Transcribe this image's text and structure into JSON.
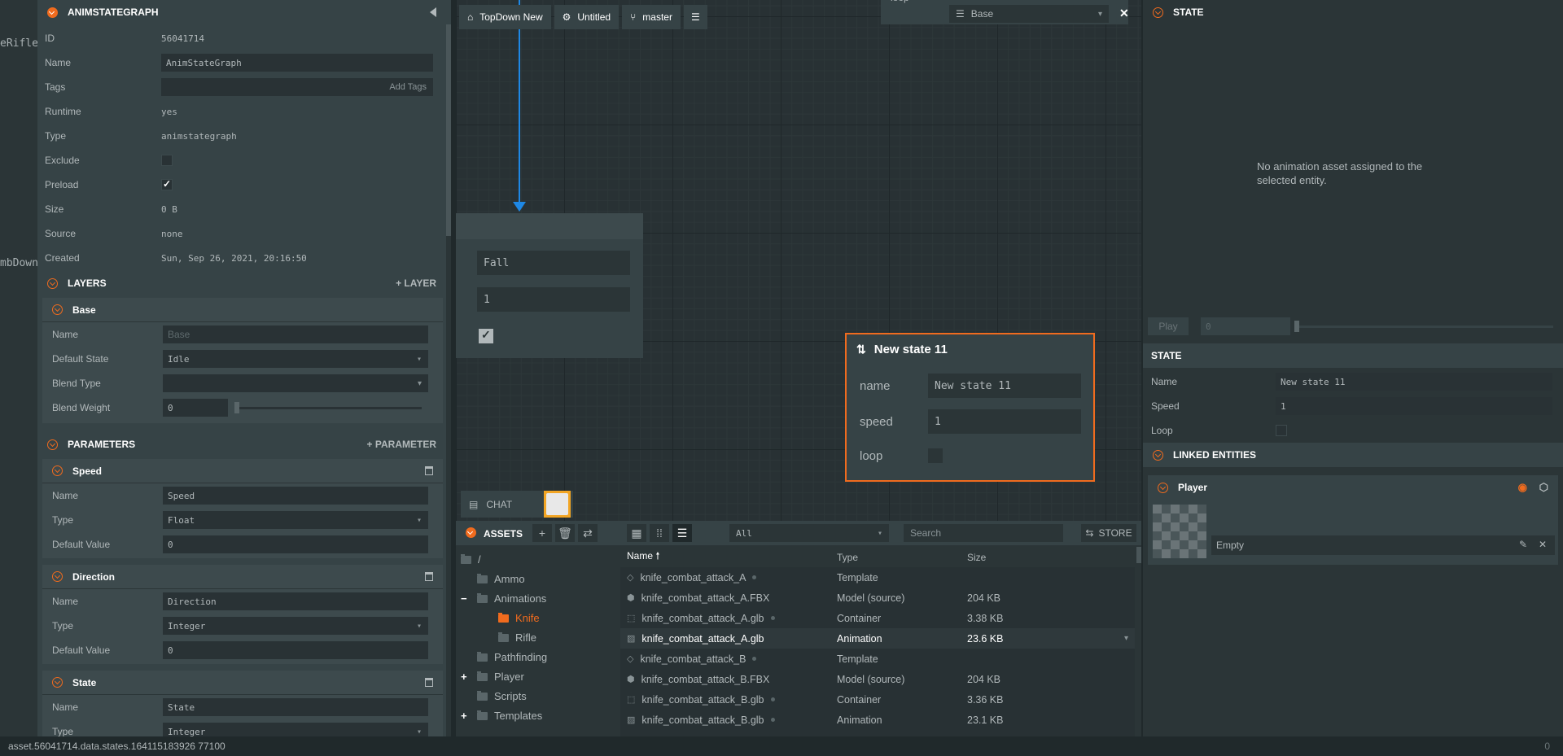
{
  "left_strip": {
    "line1": "eRifle",
    "line2": "mbDown"
  },
  "inspector": {
    "title": "ANIMSTATEGRAPH",
    "props": [
      {
        "label": "ID",
        "value": "56041714"
      },
      {
        "label": "Name",
        "value": "AnimStateGraph"
      },
      {
        "label": "Tags",
        "value": "",
        "action": "Add Tags"
      },
      {
        "label": "Runtime",
        "value": "yes"
      },
      {
        "label": "Type",
        "value": "animstategraph"
      },
      {
        "label": "Exclude",
        "checked": false
      },
      {
        "label": "Preload",
        "checked": true
      },
      {
        "label": "Size",
        "value": "0 B"
      },
      {
        "label": "Source",
        "value": "none"
      },
      {
        "label": "Created",
        "value": "Sun, Sep 26, 2021, 20:16:50"
      }
    ],
    "layers": {
      "title": "LAYERS",
      "add_label": "LAYER",
      "base": {
        "title": "Base",
        "name_label": "Name",
        "name_placeholder": "Base",
        "default_state_label": "Default State",
        "default_state_value": "Idle",
        "blend_type_label": "Blend Type",
        "blend_type_value": "",
        "blend_weight_label": "Blend Weight",
        "blend_weight_value": "0"
      }
    },
    "parameters": {
      "title": "PARAMETERS",
      "add_label": "PARAMETER",
      "items": [
        {
          "title": "Speed",
          "name": "Speed",
          "type": "Float",
          "default": "0"
        },
        {
          "title": "Direction",
          "name": "Direction",
          "type": "Integer",
          "default": "0"
        },
        {
          "title": "State",
          "name": "State",
          "type": "Integer",
          "default": ""
        }
      ],
      "name_label": "Name",
      "type_label": "Type",
      "default_label": "Default Value"
    }
  },
  "toolbar": {
    "project": "TopDown New",
    "scene": "Untitled",
    "branch": "master"
  },
  "layer_select": {
    "top_label": "loop",
    "value": "Base"
  },
  "graph": {
    "node_left": {
      "name": "Fall",
      "speed": "1",
      "loop": true
    },
    "node_selected": {
      "title": "New state 11",
      "name_label": "name",
      "name_value": "New state 11",
      "speed_label": "speed",
      "speed_value": "1",
      "loop_label": "loop",
      "loop": false
    }
  },
  "chat": {
    "label": "CHAT"
  },
  "assets": {
    "title": "ASSETS",
    "filter": "All",
    "search_placeholder": "Search",
    "store_label": "STORE",
    "tree": [
      {
        "label": "/",
        "level": 0
      },
      {
        "label": "Ammo",
        "level": 1
      },
      {
        "label": "Animations",
        "level": 1,
        "expanded": true
      },
      {
        "label": "Knife",
        "level": 2,
        "selected": true
      },
      {
        "label": "Rifle",
        "level": 2
      },
      {
        "label": "Pathfinding",
        "level": 1
      },
      {
        "label": "Player",
        "level": 1,
        "collapsed": true
      },
      {
        "label": "Scripts",
        "level": 1
      },
      {
        "label": "Templates",
        "level": 1,
        "collapsed": true
      }
    ],
    "columns": [
      "Name",
      "Type",
      "Size"
    ],
    "rows": [
      {
        "icon": "template-icon",
        "name": "knife_combat_attack_A",
        "dot": true,
        "type": "Template",
        "size": ""
      },
      {
        "icon": "model-icon",
        "name": "knife_combat_attack_A.FBX",
        "dot": false,
        "type": "Model (source)",
        "size": "204 KB"
      },
      {
        "icon": "container-icon",
        "name": "knife_combat_attack_A.glb",
        "dot": true,
        "type": "Container",
        "size": "3.38 KB"
      },
      {
        "icon": "animation-icon",
        "name": "knife_combat_attack_A.glb",
        "dot": false,
        "type": "Animation",
        "size": "23.6 KB",
        "selected": true
      },
      {
        "icon": "template-icon",
        "name": "knife_combat_attack_B",
        "dot": true,
        "type": "Template",
        "size": ""
      },
      {
        "icon": "model-icon",
        "name": "knife_combat_attack_B.FBX",
        "dot": false,
        "type": "Model (source)",
        "size": "204 KB"
      },
      {
        "icon": "container-icon",
        "name": "knife_combat_attack_B.glb",
        "dot": true,
        "type": "Container",
        "size": "3.36 KB"
      },
      {
        "icon": "animation-icon",
        "name": "knife_combat_attack_B.glb",
        "dot": true,
        "type": "Animation",
        "size": "23.1 KB"
      }
    ]
  },
  "right_panel": {
    "state_title": "STATE",
    "empty_message": "No animation asset assigned to the selected entity.",
    "play_label": "Play",
    "play_value": "0",
    "state_section": "STATE",
    "name_label": "Name",
    "name_value": "New state 11",
    "speed_label": "Speed",
    "speed_value": "1",
    "loop_label": "Loop",
    "linked_title": "LINKED ENTITIES",
    "entity_title": "Player",
    "entity_value": "Empty"
  },
  "status_bar": {
    "path": "asset.56041714.data.states.164115183926 77100",
    "count": "0"
  },
  "colors": {
    "accent": "#f06b1e",
    "link": "#1e88e5"
  }
}
